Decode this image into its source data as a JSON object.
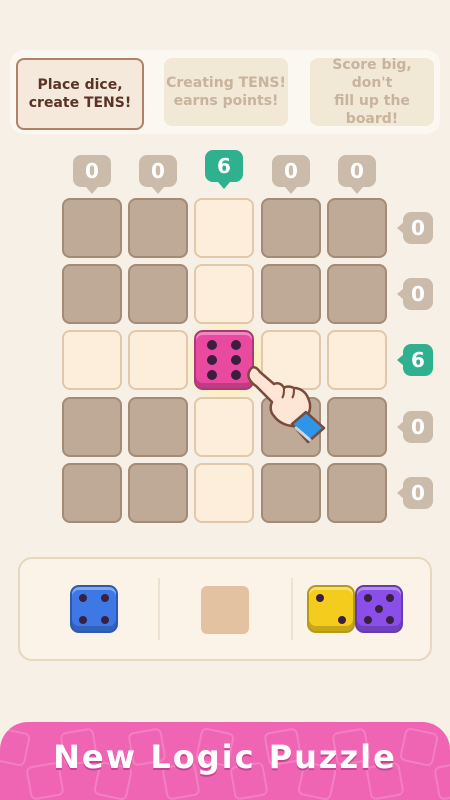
{
  "tips": [
    {
      "text": "Place dice,\ncreate TENS!",
      "active": true
    },
    {
      "text": "Creating TENS!\nearns points!",
      "active": false
    },
    {
      "text": "Score big, don't\nfill up the board!",
      "active": false
    }
  ],
  "column_hints": [
    "0",
    "0",
    "6",
    "0",
    "0"
  ],
  "row_hints": [
    "0",
    "0",
    "6",
    "0",
    "0"
  ],
  "board": {
    "rows": [
      [
        "dark",
        "dark",
        "light",
        "dark",
        "dark"
      ],
      [
        "dark",
        "dark",
        "light",
        "dark",
        "dark"
      ],
      [
        "light",
        "light",
        "die",
        "light",
        "light"
      ],
      [
        "dark",
        "dark",
        "light",
        "dark",
        "dark"
      ],
      [
        "dark",
        "dark",
        "light",
        "dark",
        "dark"
      ]
    ],
    "placed_die": {
      "value": 6,
      "color": "#e94aa0"
    }
  },
  "tray": {
    "slots": [
      {
        "dice": [
          {
            "value": 4,
            "color": "#3e78e6"
          }
        ]
      },
      {
        "dice": []
      },
      {
        "dice": [
          {
            "value": 2,
            "color": "#f3cc1d"
          },
          {
            "value": 5,
            "color": "#8a4fe8"
          }
        ]
      }
    ]
  },
  "colors": {
    "accent_green": "#2fb18f",
    "banner_pink": "#f064b4"
  },
  "banner": {
    "title": "New Logic Puzzle"
  },
  "pointer_icon": "pointing-hand-icon"
}
